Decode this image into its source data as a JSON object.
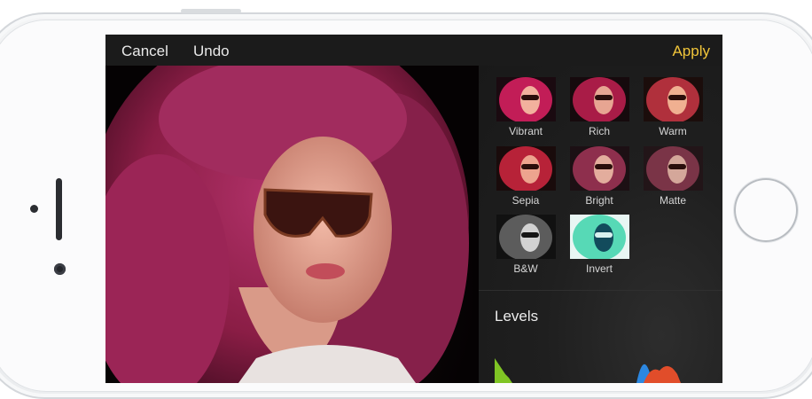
{
  "toolbar": {
    "cancel_label": "Cancel",
    "undo_label": "Undo",
    "apply_label": "Apply"
  },
  "filters": [
    {
      "label": "Vibrant"
    },
    {
      "label": "Rich"
    },
    {
      "label": "Warm"
    },
    {
      "label": "Sepia"
    },
    {
      "label": "Bright"
    },
    {
      "label": "Matte"
    },
    {
      "label": "B&W"
    },
    {
      "label": "Invert"
    }
  ],
  "levels": {
    "title": "Levels"
  },
  "colors": {
    "accent": "#f2c63a",
    "toolbar_bg": "#1b1b1b",
    "panel_bg": "#1f1f1f",
    "hair": "#8f1e4a"
  }
}
